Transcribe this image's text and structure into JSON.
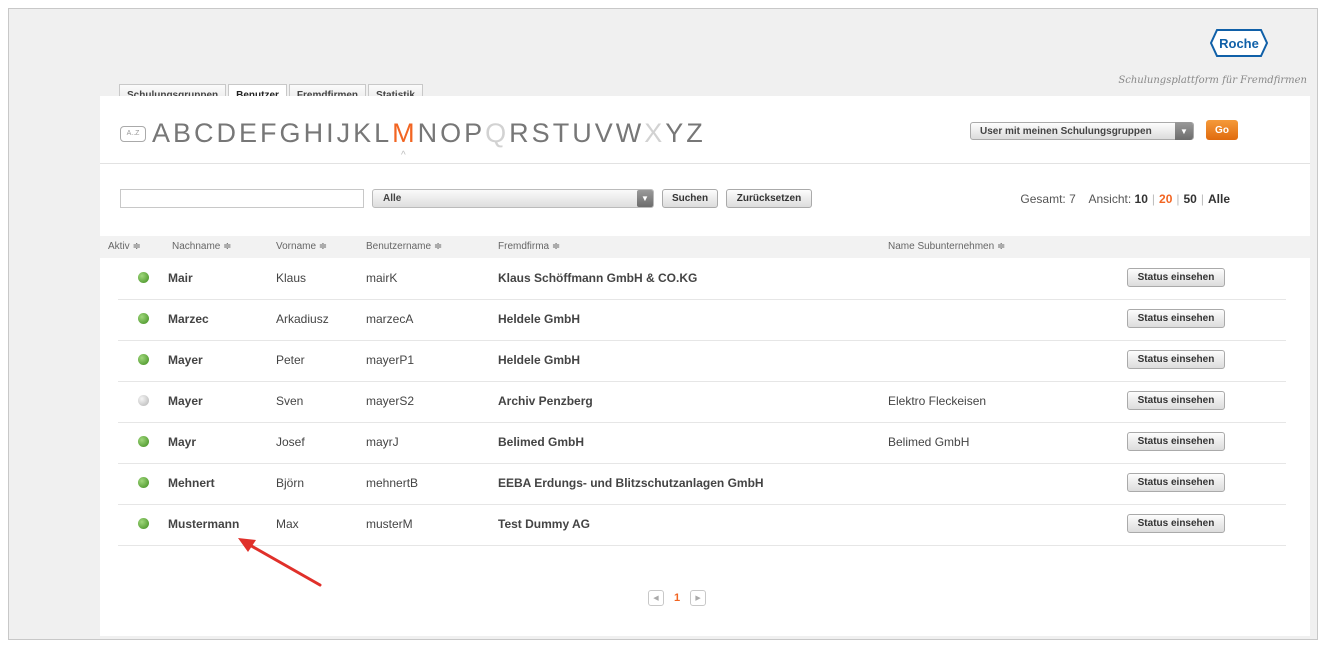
{
  "header": {
    "brand": "Roche",
    "tagline": "Schulungsplattform für Fremdfirmen",
    "colors": {
      "accent": "#f26522",
      "brand_blue": "#1060a8",
      "active": "#4c9a2a",
      "inactive": "#c4c4c4"
    }
  },
  "tabs": [
    {
      "label": "Schulungsgruppen"
    },
    {
      "label": "Benutzer",
      "active": true
    },
    {
      "label": "Fremdfirmen"
    },
    {
      "label": "Statistik"
    }
  ],
  "alphabet": {
    "az_icon": "A..Z",
    "letters": [
      "A",
      "B",
      "C",
      "D",
      "E",
      "F",
      "G",
      "H",
      "I",
      "J",
      "K",
      "L",
      "M",
      "N",
      "O",
      "P",
      "Q",
      "R",
      "S",
      "T",
      "U",
      "V",
      "W",
      "X",
      "Y",
      "Z"
    ],
    "selected": "M",
    "disabled": [
      "Q",
      "X"
    ]
  },
  "group_filter": {
    "value": "User mit meinen Schulungsgruppen",
    "go_label": "Go"
  },
  "search": {
    "query": "",
    "filter_value": "Alle",
    "search_label": "Suchen",
    "reset_label": "Zurücksetzen"
  },
  "counts": {
    "total_label": "Gesamt:",
    "total": "7",
    "view_label": "Ansicht:",
    "options": [
      "10",
      "20",
      "50",
      "Alle"
    ],
    "selected": "20"
  },
  "table": {
    "columns": {
      "aktiv": "Aktiv ≑",
      "nachname": "Nachname ≑",
      "vorname": "Vorname ≑",
      "benutzername": "Benutzername ≑",
      "fremdfirma": "Fremdfirma ≑",
      "subunternehmen": "Name Subunternehmen ≑"
    },
    "action_label": "Status einsehen",
    "rows": [
      {
        "active": true,
        "nachname": "Mair",
        "vorname": "Klaus",
        "benutzername": "mairK",
        "fremdfirma": "Klaus Schöffmann GmbH & CO.KG",
        "sub": ""
      },
      {
        "active": true,
        "nachname": "Marzec",
        "vorname": "Arkadiusz",
        "benutzername": "marzecA",
        "fremdfirma": "Heldele GmbH",
        "sub": ""
      },
      {
        "active": true,
        "nachname": "Mayer",
        "vorname": "Peter",
        "benutzername": "mayerP1",
        "fremdfirma": "Heldele GmbH",
        "sub": ""
      },
      {
        "active": false,
        "nachname": "Mayer",
        "vorname": "Sven",
        "benutzername": "mayerS2",
        "fremdfirma": "Archiv Penzberg",
        "sub": "Elektro Fleckeisen"
      },
      {
        "active": true,
        "nachname": "Mayr",
        "vorname": "Josef",
        "benutzername": "mayrJ",
        "fremdfirma": "Belimed GmbH",
        "sub": "Belimed GmbH"
      },
      {
        "active": true,
        "nachname": "Mehnert",
        "vorname": "Björn",
        "benutzername": "mehnertB",
        "fremdfirma": "EEBA Erdungs- und Blitzschutzanlagen GmbH",
        "sub": ""
      },
      {
        "active": true,
        "nachname": "Mustermann",
        "vorname": "Max",
        "benutzername": "musterM",
        "fremdfirma": "Test Dummy AG",
        "sub": ""
      }
    ]
  },
  "pagination": {
    "current": "1",
    "prev_icon": "chevron-left-icon",
    "next_icon": "chevron-right-icon"
  }
}
